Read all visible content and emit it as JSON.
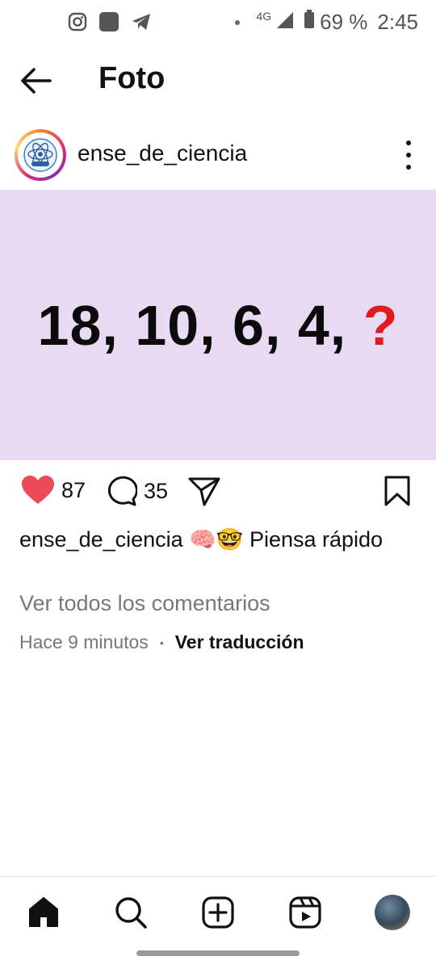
{
  "status_bar": {
    "icons_left": [
      "instagram-icon",
      "app-square-icon",
      "telegram-icon"
    ],
    "network": "4G",
    "battery": "69 %",
    "time": "2:45"
  },
  "header": {
    "title": "Foto"
  },
  "post": {
    "username": "ense_de_ciencia",
    "image_text": "18, 10, 6, 4,",
    "image_question_mark": "?",
    "image_background": "#e8daf3",
    "likes": "87",
    "comments": "35",
    "like_color": "#ed4956",
    "caption_user": "ense_de_ciencia",
    "caption_emojis": "🧠🤓",
    "caption_text": "Piensa rápido",
    "view_comments": "Ver todos los comentarios",
    "time_ago": "Hace 9 minutos",
    "translate": "Ver traducción"
  },
  "nav": {
    "items": [
      "home-icon",
      "search-icon",
      "create-icon",
      "reels-icon",
      "profile-avatar"
    ]
  }
}
